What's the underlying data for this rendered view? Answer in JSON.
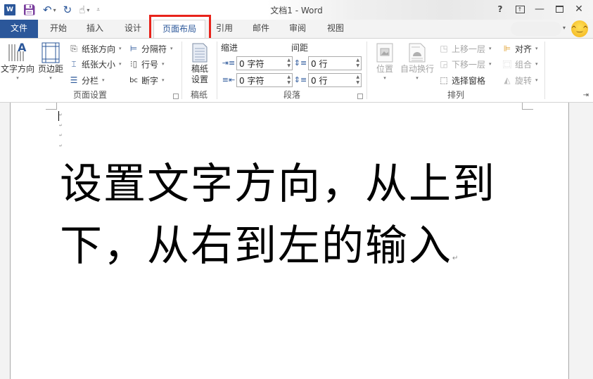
{
  "titlebar": {
    "title": "文档1 - Word",
    "app_icon": "W",
    "qat": {
      "save_icon": "save-icon",
      "undo_icon": "undo-icon",
      "redo_icon": "redo-icon",
      "touch_icon": "touch-mode-icon",
      "customize_icon": "customize-qat-icon"
    },
    "controls": {
      "help": "?",
      "restore_ribbon": "⊼",
      "minimize": "—",
      "maximize": "☐",
      "close": "✕"
    }
  },
  "tabs": [
    {
      "label": "文件",
      "active": false
    },
    {
      "label": "开始",
      "active": false
    },
    {
      "label": "插入",
      "active": false
    },
    {
      "label": "设计",
      "active": false
    },
    {
      "label": "页面布局",
      "active": true
    },
    {
      "label": "引用",
      "active": false
    },
    {
      "label": "邮件",
      "active": false
    },
    {
      "label": "审阅",
      "active": false
    },
    {
      "label": "视图",
      "active": false
    }
  ],
  "highlight_color": "#e8231b",
  "accent_color": "#2b579a",
  "ribbon": {
    "page_setup": {
      "label": "页面设置",
      "text_direction": "文字方向",
      "margins": "页边距",
      "orientation": "纸张方向",
      "size": "纸张大小",
      "columns": "分栏",
      "breaks": "分隔符",
      "line_numbers": "行号",
      "hyphenation": "断字"
    },
    "manuscript": {
      "label": "稿纸",
      "setup_line1": "稿纸",
      "setup_line2": "设置"
    },
    "paragraph": {
      "label": "段落",
      "indent_header": "缩进",
      "spacing_header": "间距",
      "indent_left": "0 字符",
      "indent_right": "0 字符",
      "spacing_before": "0 行",
      "spacing_after": "0 行"
    },
    "arrange": {
      "label": "排列",
      "position": "位置",
      "wrap_text": "自动换行",
      "bring_forward": "上移一层",
      "send_backward": "下移一层",
      "selection_pane": "选择窗格",
      "align": "对齐",
      "group": "组合",
      "rotate": "旋转"
    }
  },
  "document": {
    "body_text": "设置文字方向，从上到下，从右到左的输入"
  }
}
